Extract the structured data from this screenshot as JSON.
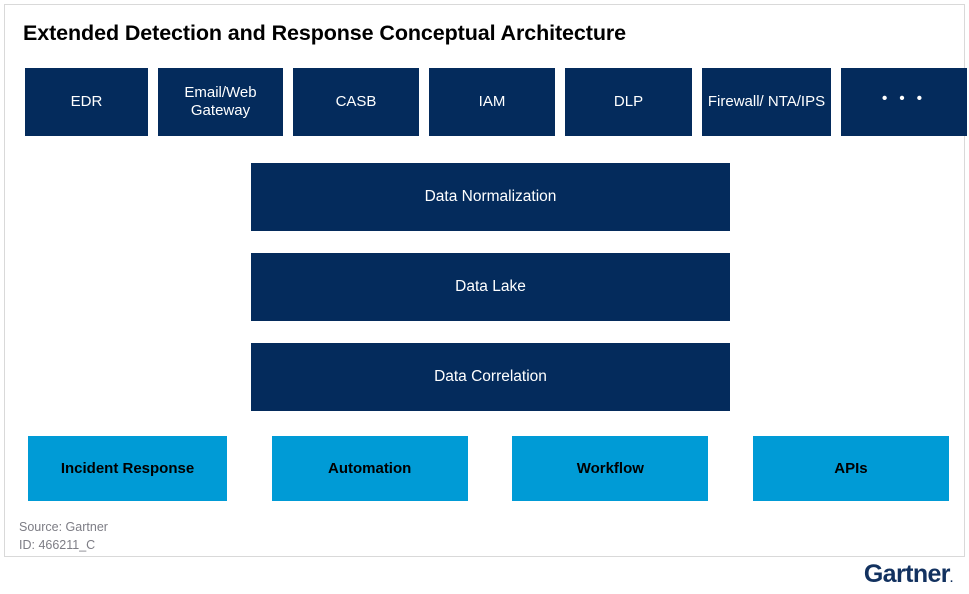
{
  "slide": {
    "title": "Extended Detection and Response Conceptual Architecture",
    "colors": {
      "navy": "#042B5C",
      "cyan": "#009BD6",
      "logo_navy": "#12315F",
      "note_gray": "#7d7d85",
      "card_border": "#d9d9d9",
      "background": "#ffffff"
    }
  },
  "sources_row": {
    "items": [
      {
        "label": "EDR"
      },
      {
        "label": "Email/Web Gateway"
      },
      {
        "label": "CASB"
      },
      {
        "label": "IAM"
      },
      {
        "label": "DLP"
      },
      {
        "label": "Firewall/ NTA/IPS"
      },
      {
        "label": "• • •"
      }
    ]
  },
  "pipeline": {
    "layers": [
      {
        "label": "Data Normalization"
      },
      {
        "label": "Data Lake"
      },
      {
        "label": "Data Correlation"
      }
    ]
  },
  "capabilities_row": {
    "items": [
      {
        "label": "Incident Response"
      },
      {
        "label": "Automation"
      },
      {
        "label": "Workflow"
      },
      {
        "label": "APIs"
      }
    ]
  },
  "note": {
    "source": "Source: Gartner",
    "id": "ID: 466211_C"
  },
  "footer": {
    "brand": "Gartner",
    "brand_mark": "."
  }
}
